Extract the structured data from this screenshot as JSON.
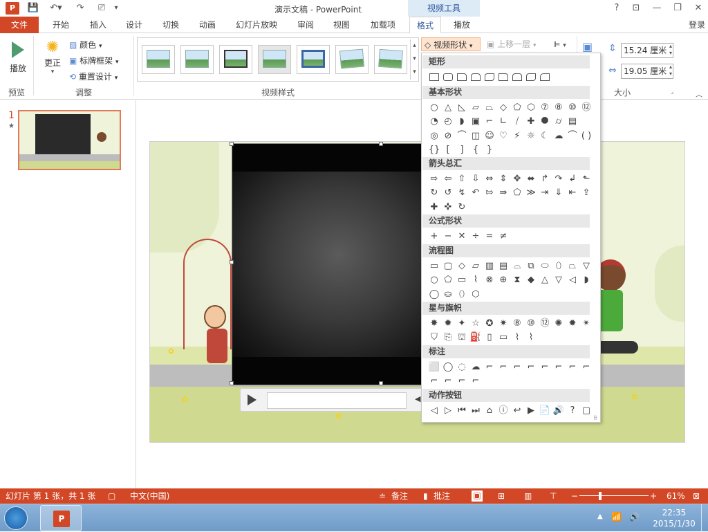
{
  "app": {
    "window_title": "演示文稿 - PowerPoint",
    "contextual_group": "视频工具",
    "signin": "登录",
    "help": "?"
  },
  "tabs": [
    "文件",
    "开始",
    "插入",
    "设计",
    "切换",
    "动画",
    "幻灯片放映",
    "审阅",
    "视图",
    "加载项",
    "格式",
    "播放"
  ],
  "ribbon": {
    "preview": {
      "play_label": "播放",
      "group_label": "预览"
    },
    "adjust": {
      "correct_label": "更正",
      "color_label": "颜色",
      "poster_label": "标牌框架",
      "reset_label": "重置设计",
      "group_label": "调整"
    },
    "styles": {
      "group_label": "视频样式"
    },
    "shape_button": "视频形状",
    "bring_forward": "上移一层",
    "size": {
      "height_value": "15.24 厘米",
      "width_value": "19.05 厘米",
      "group_label": "大小"
    }
  },
  "slide_pane": {
    "slide_number": "1",
    "star": "★"
  },
  "shape_menu": {
    "categories": [
      "矩形",
      "基本形状",
      "箭头总汇",
      "公式形状",
      "流程图",
      "星与旗帜",
      "标注",
      "动作按钮"
    ],
    "basic_rows": [
      [
        "○",
        "△",
        "◺",
        "▱",
        "⏢",
        "◇",
        "⬠",
        "⬡",
        "⑦",
        "⑧",
        "⑩",
        "⑫"
      ],
      [
        "◔",
        "◴",
        "◗",
        "▣",
        "⌐",
        "∟",
        "⧸",
        "✚",
        "⯃",
        "⌭",
        "▤"
      ],
      [
        "◎",
        "⊘",
        "⌒",
        "◫",
        "☺",
        "♡",
        "⚡",
        "☼",
        "☾",
        "☁",
        "⌒",
        "( )"
      ],
      [
        "{}",
        "[",
        "]",
        "{",
        "}"
      ]
    ],
    "arrow_rows": [
      [
        "⇨",
        "⇦",
        "⇧",
        "⇩",
        "⇔",
        "⇕",
        "✥",
        "⬌",
        "↱",
        "↷",
        "↲",
        "⬑"
      ],
      [
        "↻",
        "↺",
        "↯",
        "↶",
        "⇰",
        "⇛",
        "⬠",
        "≫",
        "⇥",
        "⇓",
        "⇤",
        "⇪"
      ],
      [
        "✚",
        "✜",
        "↻"
      ]
    ],
    "equation_row": [
      "+",
      "−",
      "✕",
      "÷",
      "=",
      "≠"
    ],
    "flow_rows": [
      [
        "▭",
        "▢",
        "◇",
        "▱",
        "▥",
        "▤",
        "⌓",
        "⧉",
        "⬭",
        "⬯",
        "⏢",
        "▽"
      ],
      [
        "○",
        "⬠",
        "▭",
        "⌇",
        "⊗",
        "⊕",
        "⧗",
        "◆",
        "△",
        "▽",
        "◁",
        "◗"
      ],
      [
        "◯",
        "⛀",
        "⬯",
        "⬡"
      ]
    ],
    "star_rows": [
      [
        "✸",
        "✹",
        "✦",
        "☆",
        "✪",
        "✷",
        "⑧",
        "⑩",
        "⑫",
        "✺",
        "✹",
        "✴"
      ],
      [
        "⛉",
        "⎘",
        "⛫",
        "⛽",
        "▯",
        "▭",
        "⌇",
        "⌇"
      ]
    ],
    "callout_rows": [
      [
        "⬜",
        "◯",
        "◌",
        "☁",
        "⌐",
        "⌐",
        "⌐",
        "⌐",
        "⌐",
        "⌐",
        "⌐",
        "⌐"
      ],
      [
        "⌐",
        "⌐",
        "⌐",
        "⌐"
      ]
    ],
    "action_row": [
      "◁",
      "▷",
      "⏮",
      "⏭",
      "⌂",
      "ⓘ",
      "↩",
      "▶",
      "📄",
      "🔊",
      "?",
      "▢"
    ]
  },
  "statusbar": {
    "slide_info": "幻灯片 第 1 张，共 1 张",
    "language": "中文(中国)",
    "notes": "备注",
    "comments": "批注",
    "zoom": "61%"
  },
  "taskbar": {
    "time": "22:35",
    "date": "2015/1/30"
  },
  "colors": {
    "accent": "#d24726",
    "context": "#ddebf7",
    "context_text": "#2b579a"
  }
}
